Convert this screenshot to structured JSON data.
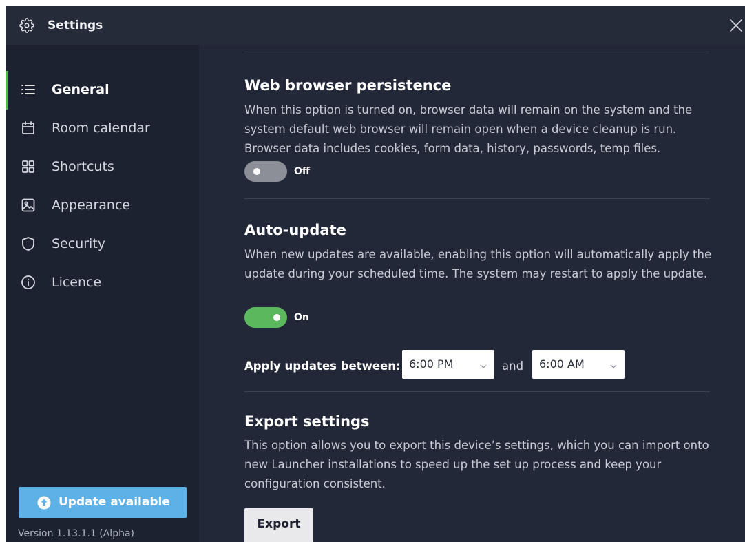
{
  "window": {
    "title": "Settings"
  },
  "sidebar": {
    "items": [
      {
        "label": "General",
        "icon": "list-icon",
        "active": true
      },
      {
        "label": "Room calendar",
        "icon": "calendar-icon",
        "active": false
      },
      {
        "label": "Shortcuts",
        "icon": "grid-icon",
        "active": false
      },
      {
        "label": "Appearance",
        "icon": "image-icon",
        "active": false
      },
      {
        "label": "Security",
        "icon": "shield-icon",
        "active": false
      },
      {
        "label": "Licence",
        "icon": "info-icon",
        "active": false
      }
    ],
    "update_button_label": "Update available",
    "version": "Version 1.13.1.1 (Alpha)"
  },
  "sections": {
    "web_browser": {
      "title": "Web browser persistence",
      "description": "When this option is turned on, browser data will remain on the system and the system default web browser will remain open when a device cleanup is run. Browser data includes cookies, form data, history, passwords, temp files.",
      "toggle_state": "Off"
    },
    "auto_update": {
      "title": "Auto-update",
      "description": "When new updates are available, enabling this option will automatically apply the update during your scheduled time. The system may restart to apply the update.",
      "toggle_state": "On",
      "apply_label": "Apply updates between:",
      "start_time": "6:00 PM",
      "and_label": "and",
      "end_time": "6:00 AM"
    },
    "export": {
      "title": "Export settings",
      "description": "This option allows you to export this device’s settings, which you can import onto new Launcher installations to speed up the set up process and keep your configuration consistent.",
      "button_label": "Export"
    }
  },
  "colors": {
    "accent_green": "#59b34b",
    "toggle_on": "#5cb85c",
    "update_blue": "#5db1e6",
    "background": "#232838",
    "sidebar": "#1d2230"
  }
}
